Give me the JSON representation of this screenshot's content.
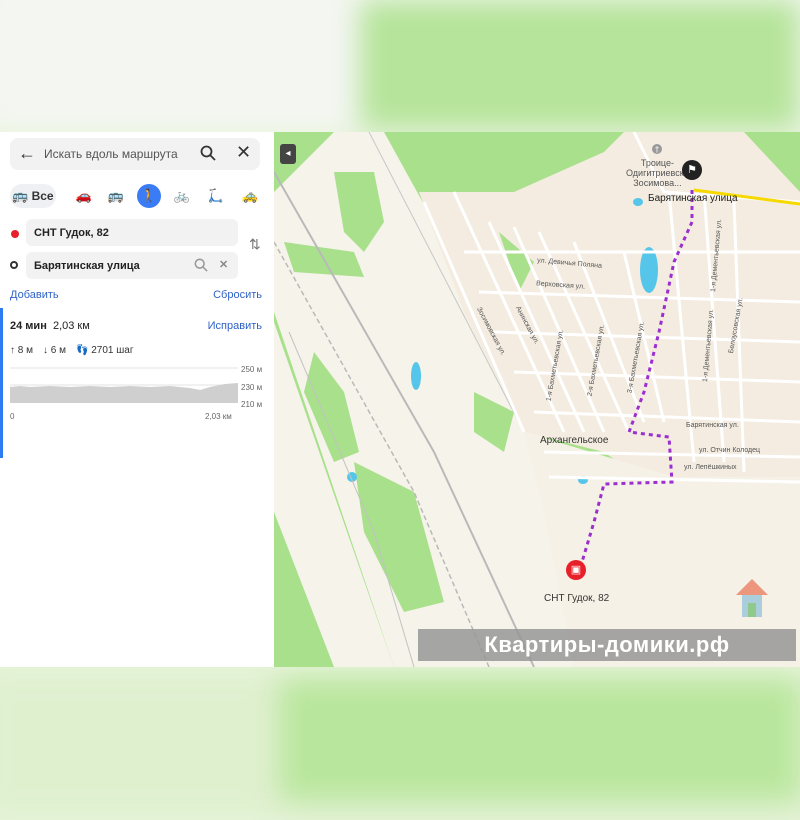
{
  "search": {
    "placeholder": "Искать вдоль маршрута"
  },
  "modes": {
    "all_label": "Все"
  },
  "route_points": {
    "from": "СНТ Гудок, 82",
    "to": "Барятинская улица"
  },
  "actions": {
    "add": "Добавить",
    "reset": "Сбросить",
    "fix": "Исправить"
  },
  "route": {
    "time": "24 мин",
    "distance": "2,03 км",
    "ascent": "8 м",
    "descent": "6 м",
    "steps": "2701 шаг"
  },
  "elevation": {
    "y_labels": [
      "250 м",
      "230 м",
      "210 м"
    ],
    "x_start": "0",
    "x_end": "2,03 км"
  },
  "map": {
    "church": "Троице-Одигитриевская Зосимова...",
    "church_line1": "Троице-",
    "church_line2": "Одигитриевска",
    "church_line3": "Зосимова...",
    "dest_label": "Барятинская улица",
    "start_label": "СНТ Гудок, 82",
    "village": "Архангельское",
    "streets": {
      "devichya": "ул. Девичья Поляна",
      "verkhovskaya": "Верховская ул.",
      "anninskaya": "Анинская ул.",
      "zosimovskaya": "Зосимовская ул.",
      "bakhm1": "1-я Бахметьевская ул.",
      "bakhm2": "2-я Бахметьевская ул.",
      "bakhm3": "3-я Бахметьевская ул.",
      "dement1": "1-я Дементьевская ул.",
      "dement2": "1-я Дементьевская ул.",
      "belousovskaya": "Белоусовская ул.",
      "baryat_ul": "Барятинская ул.",
      "otchin": "ул. Отчин Колодец",
      "lepesh": "ул. Лепёшкиных"
    }
  },
  "watermark": "Квартиры-домики.рф",
  "colors": {
    "route": "#9b2fd0",
    "accent": "#3a7cf5",
    "start": "#e8202a",
    "forest": "#a5e08a"
  }
}
